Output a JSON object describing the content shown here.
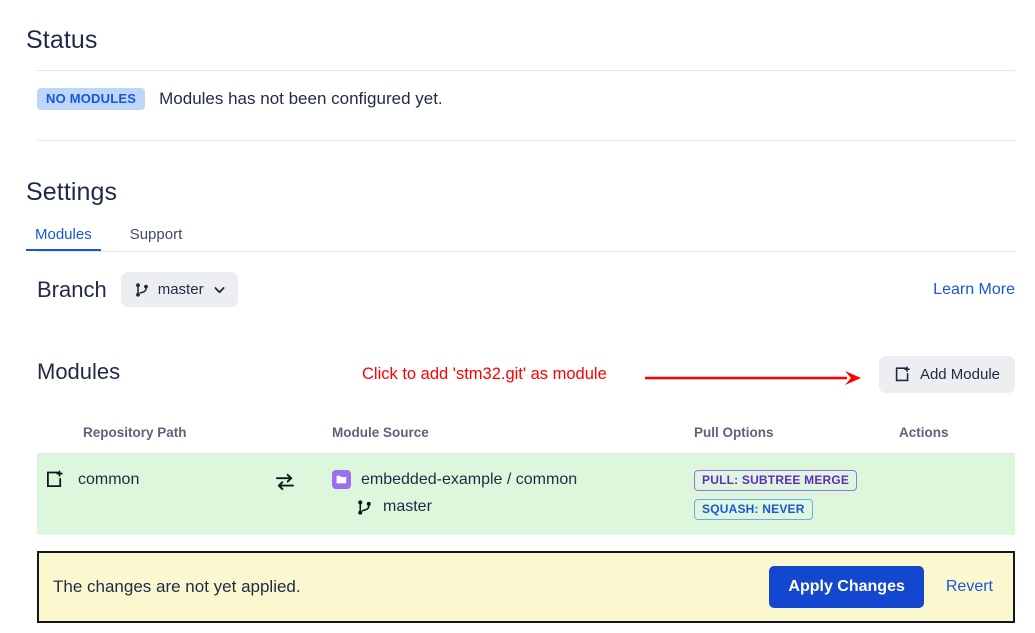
{
  "status": {
    "heading": "Status",
    "badge": "NO MODULES",
    "message": "Modules has not been configured yet.",
    "badge_bg": "#bdd7fb",
    "badge_fg": "#1a56db"
  },
  "settings": {
    "heading": "Settings",
    "tabs": [
      {
        "label": "Modules",
        "active": true
      },
      {
        "label": "Support",
        "active": false
      }
    ],
    "branch": {
      "label": "Branch",
      "selected": "master",
      "icon": "git-branch-icon",
      "caret": "⌄",
      "learn_more": "Learn More"
    }
  },
  "modules": {
    "heading": "Modules",
    "annotation": "Click to add 'stm32.git' as module",
    "annotation_color": "#ff0000",
    "add_button": {
      "label": "Add Module",
      "icon": "add-box-icon"
    },
    "table": {
      "columns": [
        "Repository Path",
        "Module Source",
        "Pull Options",
        "Actions"
      ],
      "row_bg": "#dcf7dc",
      "rows": [
        {
          "path_icon": "add-box-icon",
          "path": "common",
          "sync_icon": "swap-arrows-icon",
          "source_icon": "repository-icon",
          "source": "embedded-example / common",
          "branch_icon": "git-branch-icon",
          "branch": "master",
          "tags": [
            {
              "label": "PULL: SUBTREE MERGE",
              "style": "purple"
            },
            {
              "label": "SQUASH: NEVER",
              "style": "blue"
            }
          ],
          "actions": ""
        }
      ]
    }
  },
  "notice": {
    "message": "The changes are not yet applied.",
    "apply_label": "Apply Changes",
    "revert_label": "Revert",
    "bg": "#fbf8cf",
    "border": "#12161f",
    "apply_bg": "#1347cf"
  }
}
